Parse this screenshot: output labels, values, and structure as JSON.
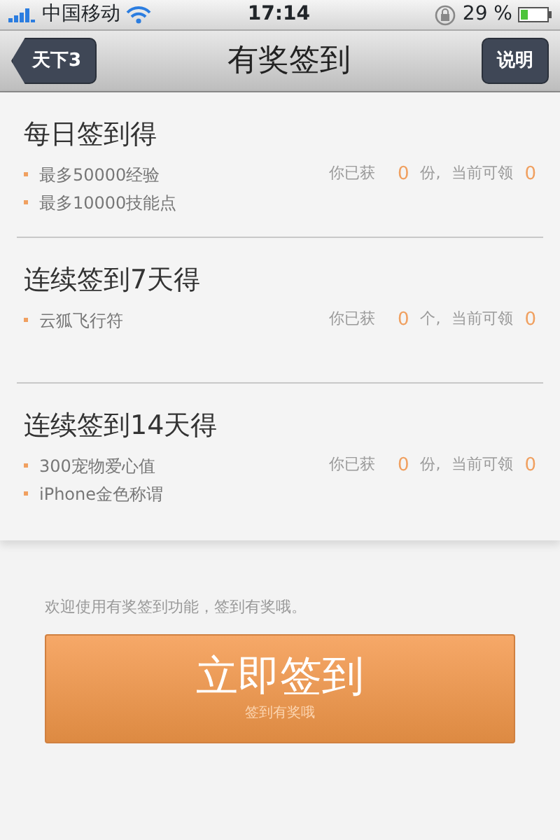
{
  "status_bar": {
    "carrier": "中国移动",
    "time": "17:14",
    "battery": "29 %"
  },
  "nav": {
    "back": "天下3",
    "title": "有奖签到",
    "action": "说明"
  },
  "sections": [
    {
      "title": "每日签到得",
      "bullets": [
        "最多50000经验",
        "最多10000技能点"
      ],
      "got_label": "你已获",
      "got": "0",
      "unit": "份,",
      "avail_label": "当前可领",
      "avail": "0"
    },
    {
      "title": "连续签到7天得",
      "bullets": [
        "云狐飞行符"
      ],
      "got_label": "你已获",
      "got": "0",
      "unit": "个,",
      "avail_label": "当前可领",
      "avail": "0"
    },
    {
      "title": "连续签到14天得",
      "bullets": [
        "300宠物爱心值",
        "iPhone金色称谓"
      ],
      "got_label": "你已获",
      "got": "0",
      "unit": "份,",
      "avail_label": "当前可领",
      "avail": "0"
    }
  ],
  "note": "欢迎使用有奖签到功能，签到有奖哦。",
  "sign_button": {
    "label": "立即签到",
    "sublabel": "签到有奖哦"
  }
}
